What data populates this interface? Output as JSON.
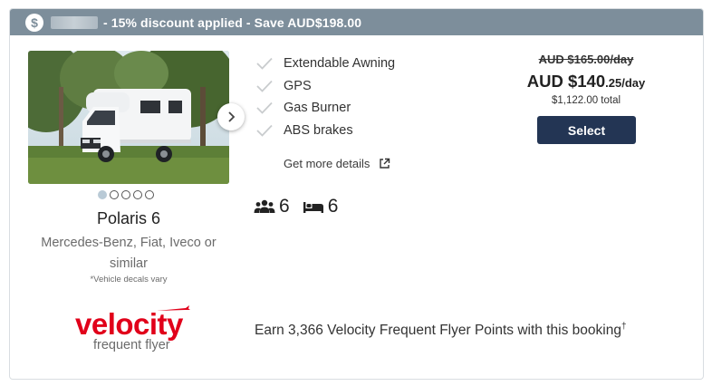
{
  "banner": {
    "icon": "dollar-icon",
    "text": "- 15% discount applied - Save AUD$198.00"
  },
  "vehicle": {
    "name": "Polaris 6",
    "models": "Mercedes-Benz, Fiat, Iveco or similar",
    "decals_note": "*Vehicle decals vary",
    "gallery": {
      "total_images": 5,
      "active_index": 0
    }
  },
  "features": [
    {
      "label": "Extendable Awning",
      "icon": "check-icon"
    },
    {
      "label": "GPS",
      "icon": "check-icon"
    },
    {
      "label": "Gas Burner",
      "icon": "check-icon"
    },
    {
      "label": "ABS brakes",
      "icon": "check-icon"
    }
  ],
  "details_link": {
    "label": "Get more details",
    "icon": "external-link-icon"
  },
  "capacity": {
    "passengers": "6",
    "passengers_icon": "people-icon",
    "berths": "6",
    "berths_icon": "bed-icon"
  },
  "pricing": {
    "old_price": "AUD $165.00/day",
    "price_main": "AUD $140",
    "price_cents": ".25/day",
    "total": "$1,122.00 total",
    "select_label": "Select"
  },
  "velocity": {
    "logo_word": "velocity",
    "logo_sub": "frequent flyer",
    "earn_text": "Earn 3,366 Velocity Frequent Flyer Points with this booking",
    "earn_mark": "†"
  },
  "colors": {
    "banner": "#7d8e9b",
    "select_button": "#233554",
    "velocity_red": "#e1001a"
  }
}
